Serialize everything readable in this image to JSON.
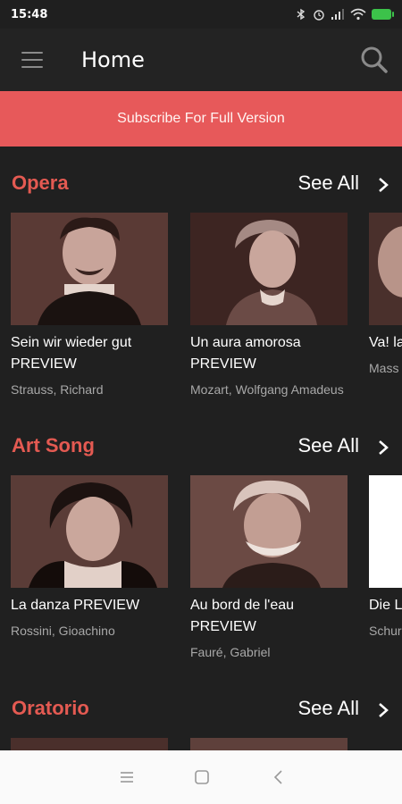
{
  "status_bar": {
    "time": "15:48"
  },
  "app_bar": {
    "title": "Home",
    "menu_icon": "hamburger-menu-icon",
    "search_icon": "search-icon"
  },
  "banner": {
    "label": "Subscribe For Full Version"
  },
  "sections": [
    {
      "title": "Opera",
      "see_all": "See All",
      "cards": [
        {
          "title": "Sein wir wieder gut PREVIEW",
          "artist": "Strauss, Richard"
        },
        {
          "title": "Un aura amorosa PREVIEW",
          "artist": "Mozart, Wolfgang Amadeus"
        },
        {
          "title": "Va! la larm",
          "artist": "Mass"
        }
      ]
    },
    {
      "title": "Art Song",
      "see_all": "See All",
      "cards": [
        {
          "title": "La danza PREVIEW",
          "artist": "Rossini, Gioachino"
        },
        {
          "title": "Au bord de l'eau PREVIEW",
          "artist": "Fauré, Gabriel"
        },
        {
          "title": "Die L PREV",
          "artist": "Schur"
        }
      ]
    },
    {
      "title": "Oratorio",
      "see_all": "See All",
      "cards": []
    }
  ],
  "nav_bar": {
    "recents_icon": "recents-icon",
    "home_icon": "home-icon",
    "back_icon": "back-icon"
  },
  "colors": {
    "accent": "#e45a52",
    "banner": "#e7595a",
    "background": "#202020",
    "app_bar": "#232323"
  }
}
